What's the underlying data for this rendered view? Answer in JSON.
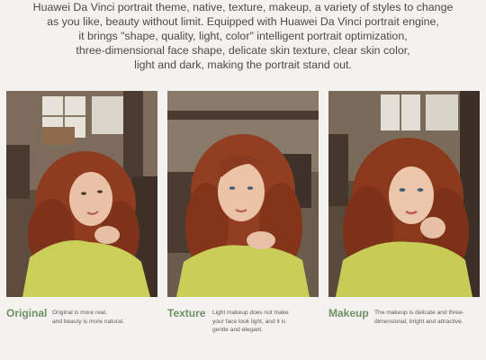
{
  "intro": {
    "lines": [
      "Huawei Da Vinci portrait theme, native, texture, makeup, a variety of styles to change",
      "as you like, beauty without limit. Equipped with Huawei Da Vinci portrait engine,",
      "it brings \"shape, quality, light, color\" intelligent portrait optimization,",
      "three-dimensional face shape, delicate skin texture, clear skin color,",
      "light and dark, making the portrait stand out."
    ]
  },
  "panels": [
    {
      "title": "Original",
      "desc_lines": [
        "Original is more real,",
        "and beauty is more natural."
      ]
    },
    {
      "title": "Texture",
      "desc_lines": [
        "Light makeup does not make",
        "your face look light, and it is",
        "gentle and elegant."
      ]
    },
    {
      "title": "Makeup",
      "desc_lines": [
        "The makeup is delicate and three-",
        "dimensional, bright and attractive."
      ]
    }
  ],
  "colors": {
    "accent": "#6f8f67",
    "background": "#f3f2ee",
    "hair": "#8e3b1f",
    "sweater": "#c9cf58"
  }
}
